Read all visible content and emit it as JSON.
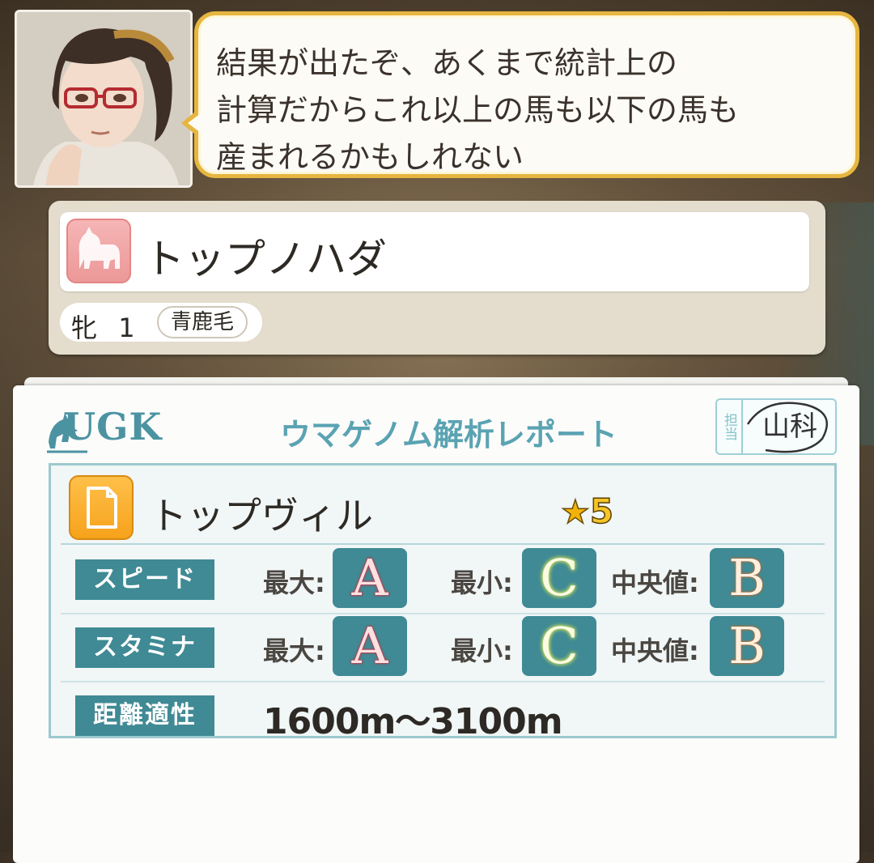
{
  "dialogue": {
    "text": "結果が出たぞ、あくまで統計上の\n計算だからこれ以上の馬も以下の馬も\n産まれるかもしれない"
  },
  "horse": {
    "name": "トップノハダ",
    "sex": "牝",
    "age": "1",
    "coat": "青鹿毛"
  },
  "report": {
    "logo_text": "UGK",
    "title": "ウマゲノム解析レポート",
    "stamp_label": "担当",
    "stamp_signature": "山科",
    "result_name": "トップヴィル",
    "rank_star": "★",
    "rank_value": "5",
    "stats": [
      {
        "label": "スピード",
        "max_label": "最大:",
        "max": "A",
        "min_label": "最小:",
        "min": "C",
        "median_label": "中央値:",
        "median": "B"
      },
      {
        "label": "スタミナ",
        "max_label": "最大:",
        "max": "A",
        "min_label": "最小:",
        "min": "C",
        "median_label": "中央値:",
        "median": "B"
      }
    ],
    "distance_label": "距離適性",
    "distance_value": "1600m〜3100m"
  },
  "colors": {
    "bubble_border": "#e6b640",
    "teal": "#3f8a94",
    "title_teal": "#5aa3b2",
    "orange_icon": "#f6a21b",
    "pink_icon": "#ec9898"
  }
}
